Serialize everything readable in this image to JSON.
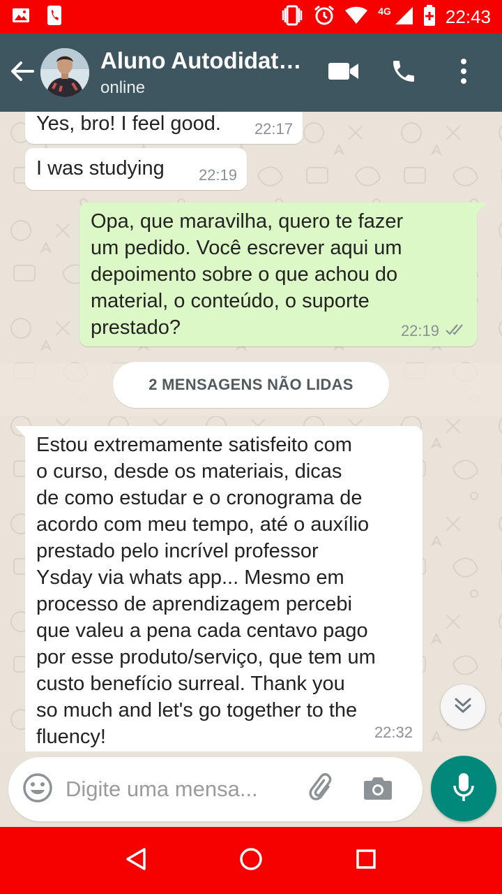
{
  "status_bar": {
    "time": "22:43",
    "network": "4G",
    "icons": [
      "image-icon",
      "phone-notification-icon",
      "vibrate-icon",
      "alarm-icon",
      "wifi-icon",
      "signal-icon",
      "battery-icon"
    ]
  },
  "app_bar": {
    "contact_name": "Aluno Autodidata...",
    "status": "online",
    "icons": [
      "back-arrow-icon",
      "video-call-icon",
      "phone-call-icon",
      "more-vertical-icon"
    ]
  },
  "messages": [
    {
      "direction": "in",
      "text": "Yes, bro! I feel good.",
      "time": "22:17"
    },
    {
      "direction": "in",
      "text": "I was studying",
      "time": "22:19"
    },
    {
      "direction": "out",
      "lines": [
        "Opa, que maravilha, quero te fazer",
        "um pedido. Você escrever aqui um",
        "depoimento sobre o que achou do",
        "material, o conteúdo, o suporte",
        "prestado?"
      ],
      "time": "22:19",
      "status": "read"
    },
    {
      "direction": "in",
      "lines": [
        "Estou extremamente satisfeito com",
        "o curso, desde os materiais, dicas",
        "de como estudar e o cronograma de",
        "acordo com meu tempo, até o auxílio",
        "prestado pelo incrível professor",
        "Ysday via whats app... Mesmo em",
        "processo de aprendizagem percebi",
        "que valeu a pena cada centavo pago",
        "por esse produto/serviço, que tem um",
        "custo benefício surreal. Thank you",
        "so much and let's go together to the",
        "fluency!"
      ],
      "time": "22:32"
    }
  ],
  "unread_banner": "2 MENSAGENS NÃO LIDAS",
  "input": {
    "placeholder": "Digite uma mensa..."
  },
  "colors": {
    "status_bar": "#f60000",
    "app_bar": "#3e5660",
    "outgoing_bubble": "#dcf8c6",
    "incoming_bubble": "#ffffff",
    "mic_button": "#00897b",
    "read_ticks": "#8a9096"
  }
}
